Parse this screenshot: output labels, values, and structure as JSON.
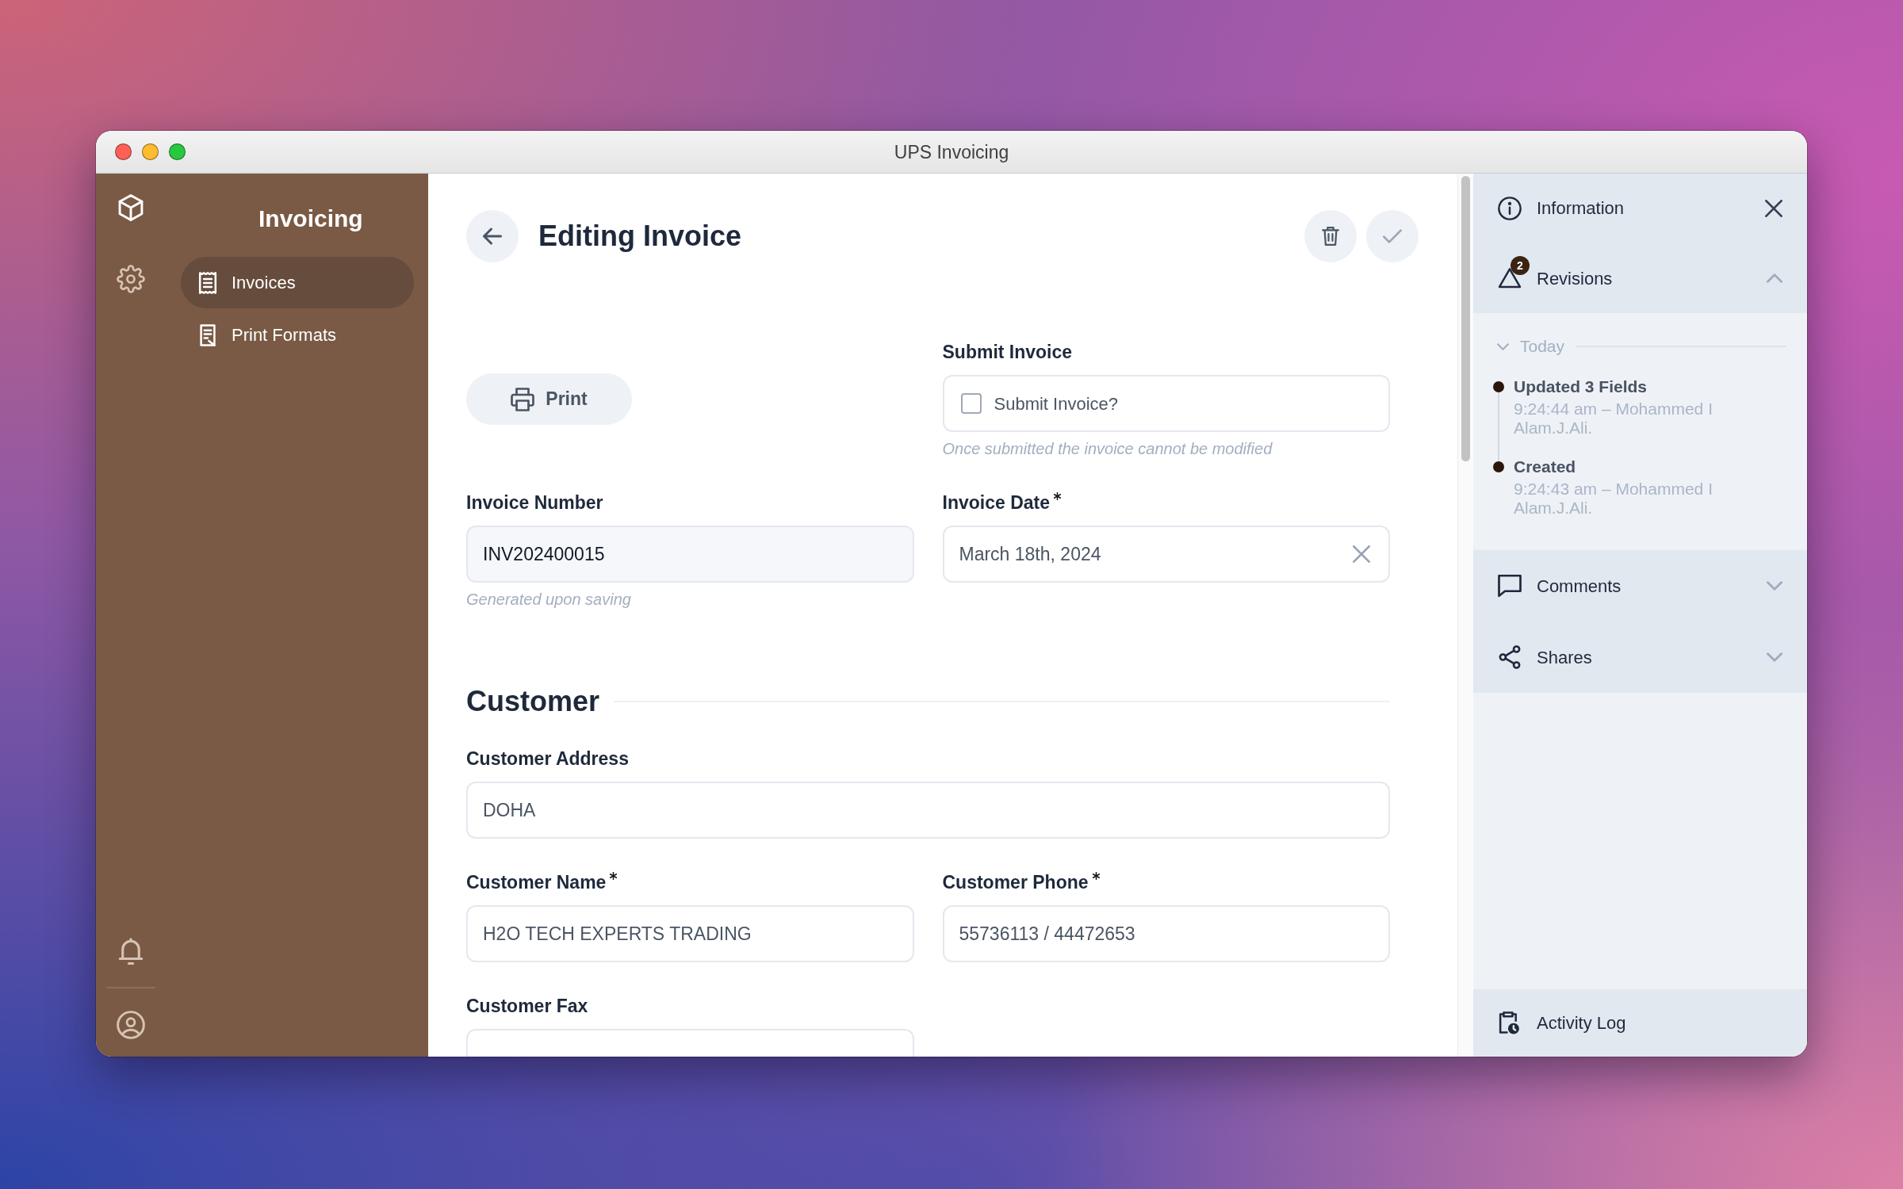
{
  "window": {
    "title": "UPS Invoicing"
  },
  "sidebar": {
    "rail": [
      {
        "selected": true
      },
      {
        "selected": false
      }
    ],
    "title": "Invoicing",
    "items": [
      {
        "label": "Invoices",
        "selected": true
      },
      {
        "label": "Print Formats",
        "selected": false
      }
    ]
  },
  "editor": {
    "title": "Editing Invoice",
    "fields": [
      {
        "kind": "button",
        "label": "Print"
      },
      {
        "kind": "check",
        "label": "Submit Invoice",
        "option": "Submit Invoice?",
        "checked": false,
        "hint": "Once submitted the invoice cannot be modified"
      },
      {
        "kind": "data",
        "label": "Invoice Number",
        "required": false,
        "readonly": true,
        "value": "INV202400015",
        "hint": "Generated upon saving"
      },
      {
        "kind": "date",
        "label": "Invoice Date",
        "required": true,
        "readonly": false,
        "value": "March 18th, 2024"
      }
    ],
    "sections": [
      {
        "title": "Customer",
        "fields": [
          {
            "kind": "text",
            "label": "Customer Address",
            "required": false,
            "readonly": false,
            "value": "DOHA"
          },
          {
            "kind": "data",
            "label": "Customer Name",
            "required": true,
            "readonly": false,
            "value": "H2O TECH EXPERTS TRADING"
          },
          {
            "kind": "data",
            "label": "Customer Phone",
            "required": true,
            "readonly": false,
            "value": "55736113 / 44472653"
          },
          {
            "kind": "data",
            "label": "Customer Fax",
            "required": false
          }
        ]
      }
    ]
  },
  "info_panel": {
    "title": "Information",
    "sections": [
      {
        "kind": "revisions",
        "title": "Revisions",
        "badge": "2",
        "expanded": true,
        "groups": [
          {
            "title": "Today",
            "expanded": true,
            "entries": [
              {
                "title": "Updated 3 Fields",
                "detail": "9:24:44 am – Mohammed I Alam.J.Ali."
              },
              {
                "title": "Created",
                "detail": "9:24:43 am – Mohammed I Alam.J.Ali."
              }
            ]
          }
        ]
      },
      {
        "kind": "comments",
        "title": "Comments",
        "expanded": false
      },
      {
        "kind": "shares",
        "title": "Shares",
        "expanded": false
      }
    ],
    "footer": {
      "label": "Activity Log"
    }
  }
}
